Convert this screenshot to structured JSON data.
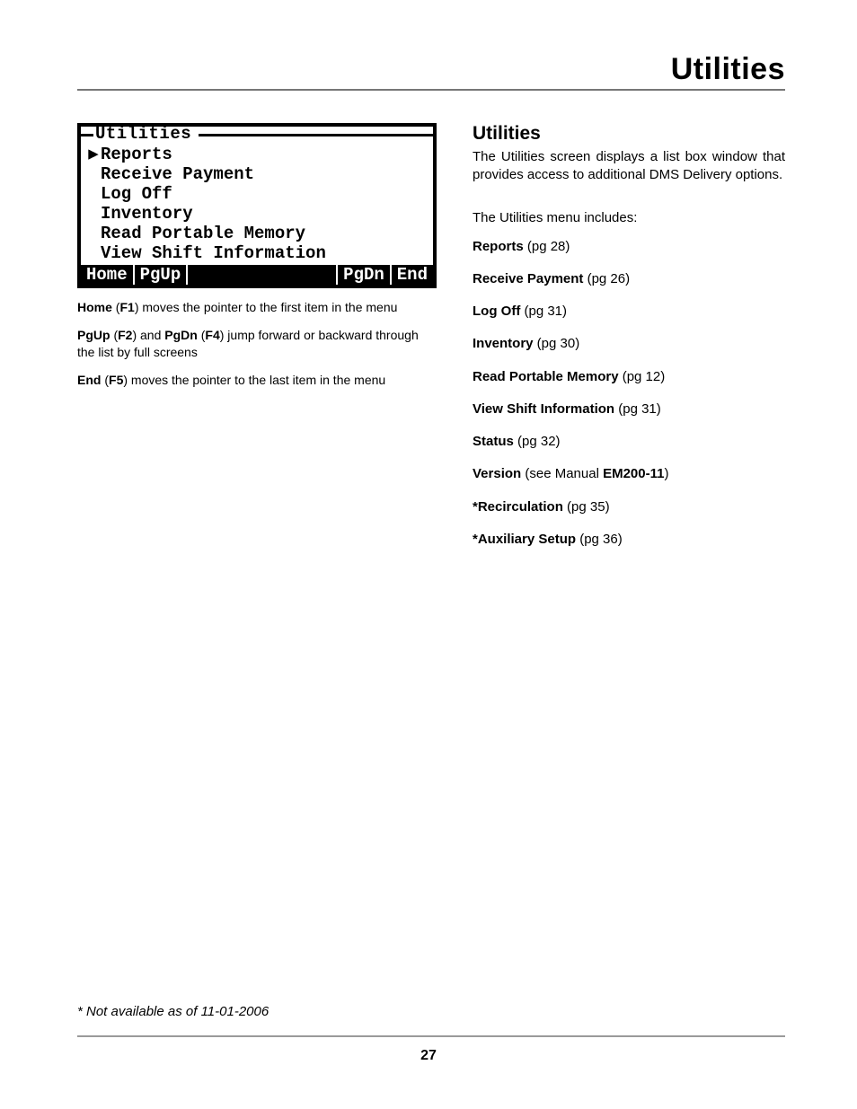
{
  "header": {
    "title": "Utilities"
  },
  "terminal": {
    "caption": "Utilities",
    "selected_index": 0,
    "items": [
      "Reports",
      "Receive Payment",
      "Log Off",
      "Inventory",
      "Read Portable Memory",
      "View Shift Information"
    ],
    "footer": {
      "home": "Home",
      "pgup": "PgUp",
      "pgdn": "PgDn",
      "end": "End"
    }
  },
  "legend": {
    "l1": {
      "b1": "Home",
      "t1": " (",
      "b2": "F1",
      "t2": ") moves the pointer to the first item in the menu"
    },
    "l2": {
      "b1": "PgUp",
      "t1": " (",
      "b2": "F2",
      "t2": ") and ",
      "b3": "PgDn",
      "t3": " (",
      "b4": "F4",
      "t4": ") jump forward or backward through the list by full screens"
    },
    "l3": {
      "b1": "End",
      "t1": " (",
      "b2": "F5",
      "t2": ") moves the pointer to the last item in the menu"
    }
  },
  "right": {
    "heading": "Utilities",
    "intro": "The Utilities screen displays a list box window that provides access to additional DMS Delivery options.",
    "subheading": "The Utilities menu includes:",
    "items": [
      {
        "name": "Reports",
        "ref": " (pg 28)"
      },
      {
        "name": "Receive Payment",
        "ref": " (pg 26)"
      },
      {
        "name": "Log Off",
        "ref": " (pg 31)"
      },
      {
        "name": "Inventory",
        "ref": " (pg 30)"
      },
      {
        "name": "Read Portable Memory",
        "ref": " (pg 12)"
      },
      {
        "name": "View Shift Information",
        "ref": " (pg 31)"
      },
      {
        "name": "Status",
        "ref": " (pg 32)"
      },
      {
        "name": "Version",
        "ref_pre": " (see Manual ",
        "ref_bold": "EM200-11",
        "ref_post": ")"
      },
      {
        "name": "*Recirculation",
        "ref": " (pg 35)"
      },
      {
        "name": "*Auxiliary Setup",
        "ref": " (pg 36)"
      }
    ]
  },
  "footnote": "*  Not available as of 11-01-2006",
  "page_number": "27"
}
